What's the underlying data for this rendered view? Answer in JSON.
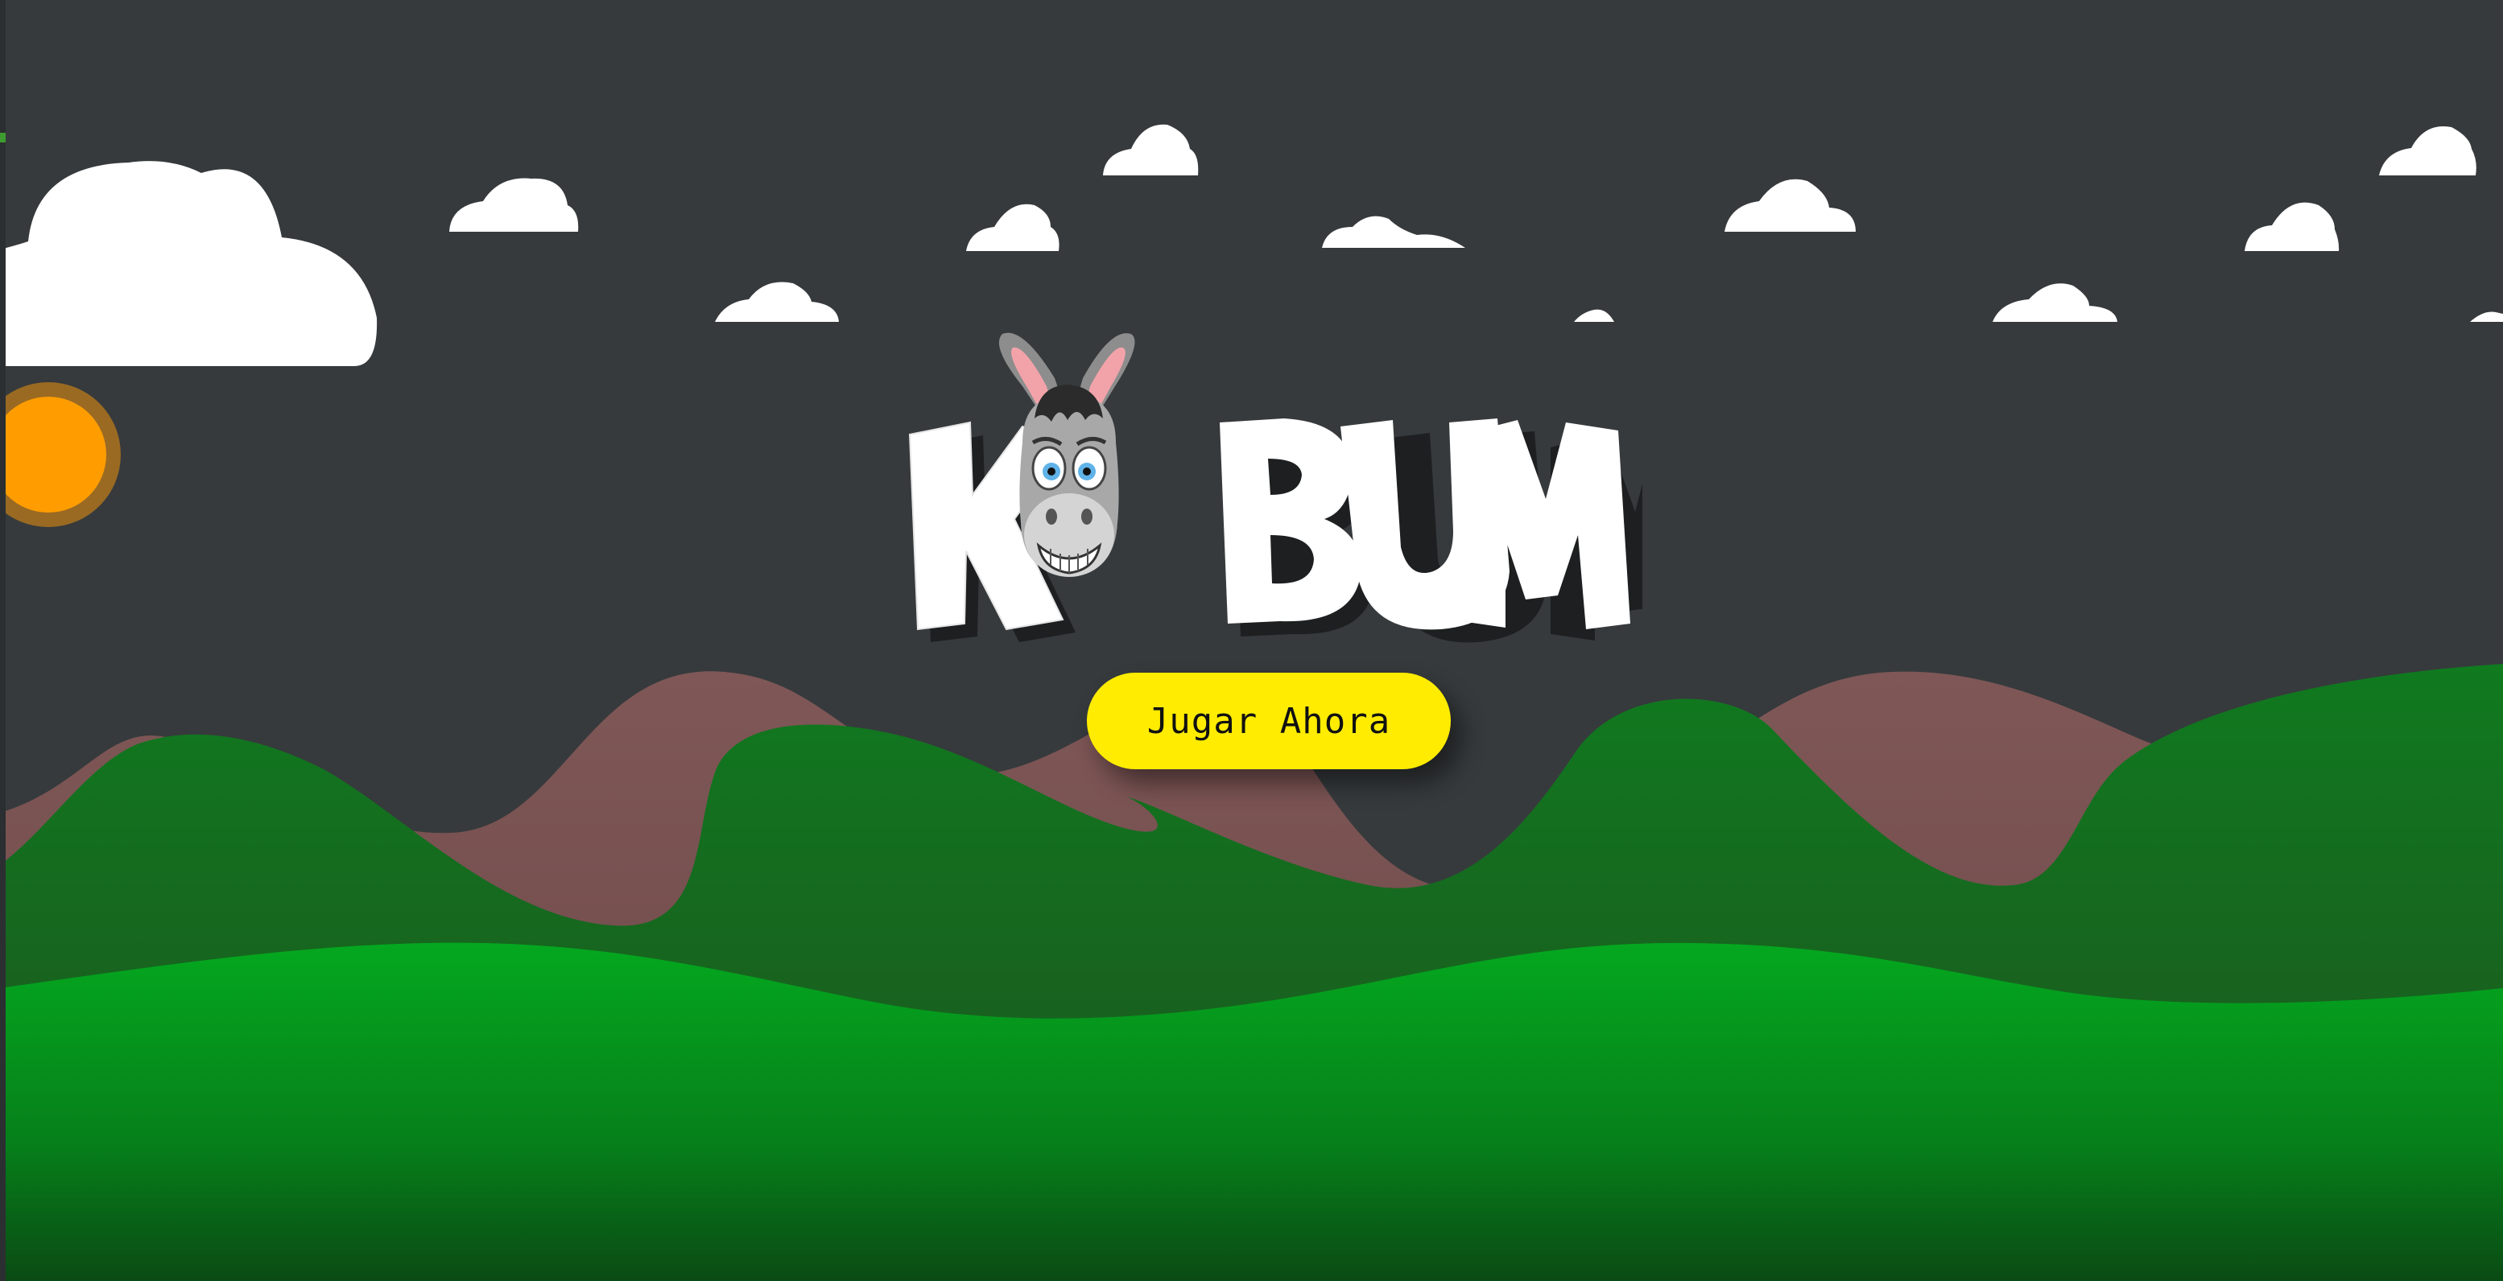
{
  "game": {
    "title": "KABUM",
    "play_button_label": "Jugar Ahora"
  },
  "icons": {
    "mascot": "donkey-head-icon",
    "sun": "sun-icon",
    "clouds": "cloud-icon"
  },
  "colors": {
    "sky": "#363a3c",
    "sun": "#ff9d00",
    "sun_ring": "#9a6a23",
    "cloud": "#ffffff",
    "button": "#ffec00",
    "button_text": "#111111",
    "hills_back": "#7a5454",
    "hills_mid": "#156f1e",
    "hills_front": "#04a11f",
    "logo_text": "#ffffff"
  }
}
